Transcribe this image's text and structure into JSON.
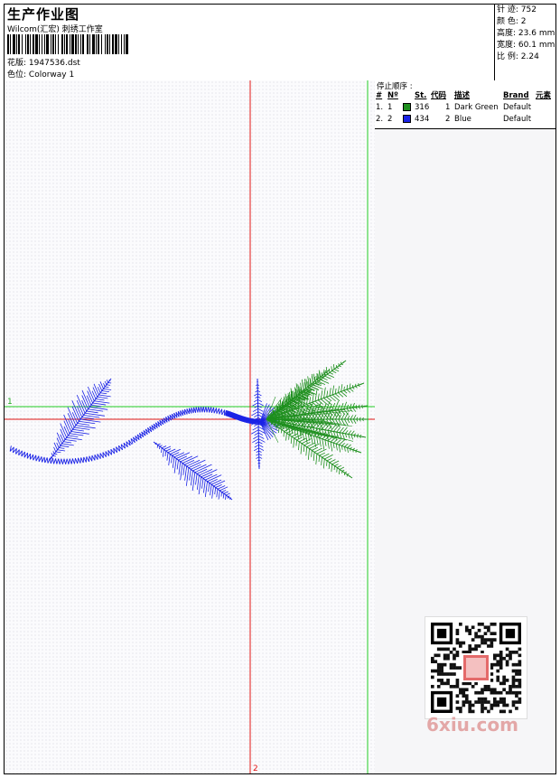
{
  "header": {
    "title": "生产作业图",
    "company": "Wilcom(汇宏) 刺绣工作室",
    "design_label": "花版:",
    "design_value": "1947536.dst",
    "color_label": "色位:",
    "color_value": "Colorway 1"
  },
  "stats": [
    {
      "label": "针 迹:",
      "value": "752"
    },
    {
      "label": "颜 色:",
      "value": "2"
    },
    {
      "label": "高度:",
      "value": "23.6 mm"
    },
    {
      "label": "宽度:",
      "value": "60.1 mm"
    },
    {
      "label": "比 例:",
      "value": "2.24"
    }
  ],
  "stop_sequence": {
    "title": "停止顺序 :",
    "headers": {
      "hash": "#",
      "no": "Nº",
      "st": "St.",
      "code": "代码",
      "desc": "描述",
      "brand": "Brand",
      "elem": "元素"
    },
    "rows": [
      {
        "index": "1.",
        "no": "1",
        "stitches": "316",
        "code": "1",
        "desc": "Dark Green",
        "brand": "Default",
        "color": "#1e8f1e"
      },
      {
        "index": "2.",
        "no": "2",
        "stitches": "434",
        "code": "2",
        "desc": "Blue",
        "brand": "Default",
        "color": "#1a22e6"
      }
    ]
  },
  "markers": {
    "h_line": "1",
    "v_line": "2"
  },
  "colors": {
    "green": "#1e8f1e",
    "blue": "#1a22e6",
    "guide_green": "#22cc22",
    "guide_red": "#e01414"
  },
  "watermark": "6xiu.com"
}
